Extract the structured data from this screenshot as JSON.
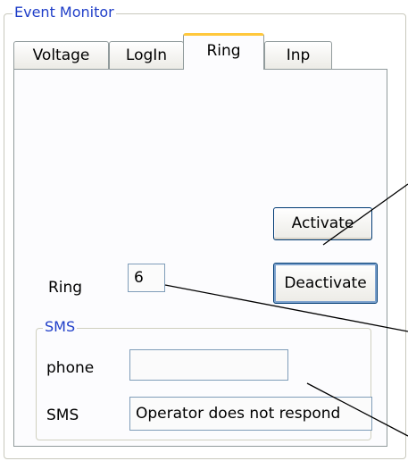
{
  "group": {
    "title": "Event Monitor"
  },
  "tabs": [
    {
      "label": "Voltage"
    },
    {
      "label": "LogIn"
    },
    {
      "label": "Ring"
    },
    {
      "label": "Inp"
    }
  ],
  "buttons": {
    "activate": "Activate",
    "deactivate": "Deactivate"
  },
  "ring": {
    "label": "Ring",
    "value": "6"
  },
  "sms": {
    "title": "SMS",
    "phone_label": "phone",
    "phone_value": "",
    "sms_label": "SMS",
    "sms_value": "Operator does not respond"
  }
}
